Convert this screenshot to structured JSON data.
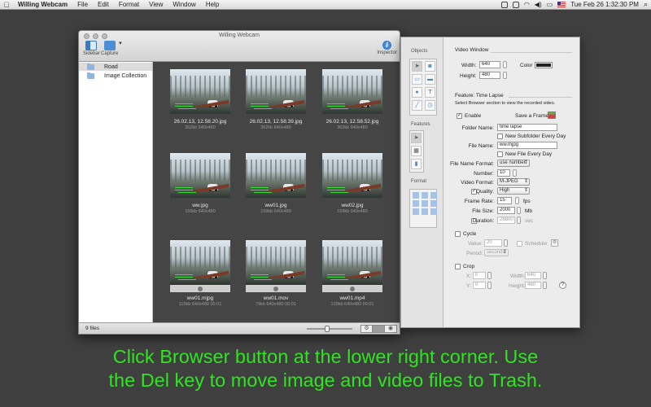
{
  "menubar": {
    "apple": "",
    "app": "Willing Webcam",
    "items": [
      "File",
      "Edit",
      "Format",
      "View",
      "Window",
      "Help"
    ],
    "datetime": "Tue Feb 26  1:32:30 PM",
    "search_icon": "magnifier-icon"
  },
  "window": {
    "title": "Willing Webcam",
    "toolbar": {
      "sidebar": "Sidebar",
      "capture": "Capture",
      "inspector": "Inspector"
    },
    "sidebar": {
      "items": [
        "Road",
        "Image Collection"
      ]
    },
    "thumbnails": [
      {
        "name": "26.02.13, 12.58.20.jpg",
        "meta": "362kb 640x480"
      },
      {
        "name": "26.02.13, 12.58.39.jpg",
        "meta": "362kb 640x480"
      },
      {
        "name": "26.02.13, 12.58.52.jpg",
        "meta": "362kb 640x480"
      },
      {
        "name": "ww.jpg",
        "meta": "159kb 640x480"
      },
      {
        "name": "ww01.jpg",
        "meta": "159kb 640x480"
      },
      {
        "name": "ww02.jpg",
        "meta": "159kb 640x480"
      },
      {
        "name": "ww01.mjpg",
        "meta": "115kb 640x480 00:01"
      },
      {
        "name": "ww01.mov",
        "meta": "79kb 640x480 00:01"
      },
      {
        "name": "ww01.mp4",
        "meta": "129kb 640x480 00:01"
      }
    ],
    "status": {
      "count": "9 files",
      "zoom": 0.45
    }
  },
  "inspector": {
    "palette": {
      "objects": "Objects",
      "features": "Features",
      "format": "Format"
    },
    "video_window": {
      "heading": "Video Window",
      "width_label": "Width:",
      "width": "640",
      "height_label": "Height:",
      "height": "480",
      "color_label": "Color",
      "color": "#222222"
    },
    "feature": {
      "heading": "Feature: Time Lapse",
      "hint": "Select Browser section to view the recorded video.",
      "enable_label": "Enable",
      "save_frame_label": "Save a Frame:",
      "folder_label": "Folder Name:",
      "folder": "time lapse",
      "new_subfolder": "New Subfolder Every Day",
      "file_label": "File Name:",
      "file": "ww.mjpg",
      "new_file": "New File Every Day",
      "format_label": "File Name Format:",
      "format": "use number",
      "number_label": "Number:",
      "number": "10",
      "video_format_label": "Video Format:",
      "video_format": "M-JPEG",
      "quality_label": "Quality:",
      "quality": "High",
      "frame_rate_label": "Frame Rate:",
      "frame_rate": "15",
      "fps": "fps",
      "file_size_label": "File Size:",
      "file_size": "2000",
      "mb": "Mb",
      "duration_label": "Duration:",
      "duration": "28800",
      "sec": "sec"
    },
    "cycle": {
      "label": "Cycle",
      "value_label": "Value:",
      "value": "20",
      "schedule": "Schedule",
      "period_label": "Period:",
      "period": "seconds"
    },
    "crop": {
      "label": "Crop",
      "x_label": "X:",
      "x": "0",
      "y_label": "Y:",
      "y": "0",
      "width_label": "Width:",
      "width": "640",
      "height_label": "Height:",
      "height": "480",
      "help": "?"
    }
  },
  "caption": {
    "line1": "Click Browser button at the lower right corner. Use",
    "line2": "the Del key to move image and video files to Trash."
  },
  "colors": {
    "caption": "#2ee51f",
    "desktop": "#3f3f3f",
    "browser_bg": "#454545"
  }
}
